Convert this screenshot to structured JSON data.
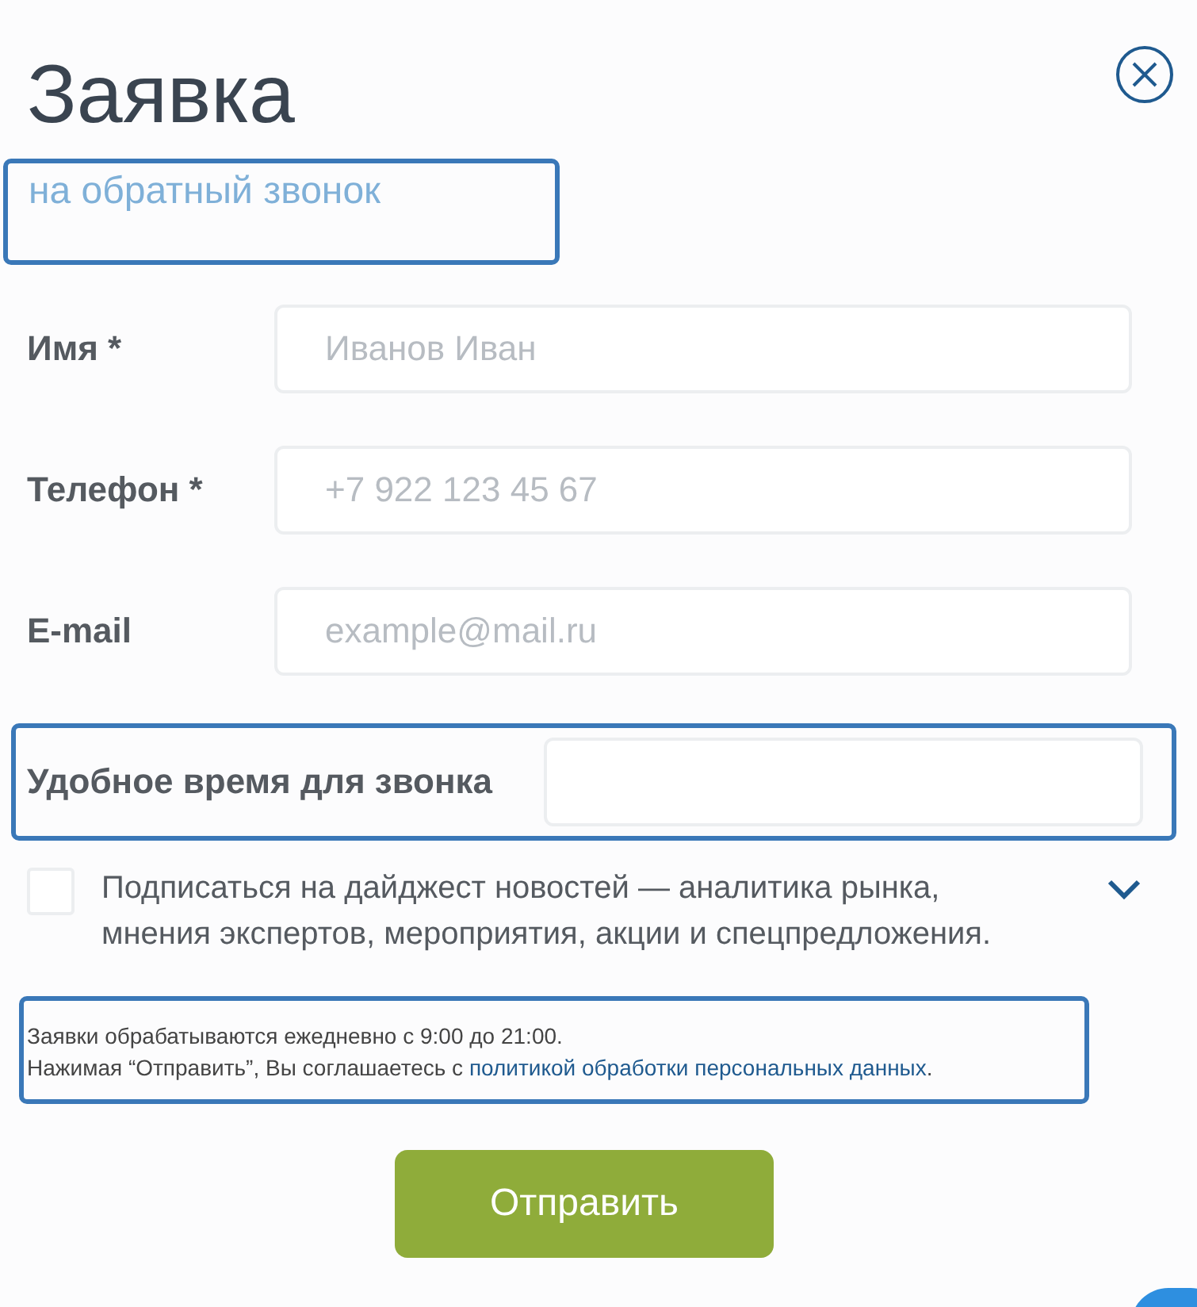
{
  "title": "Заявка",
  "subtitle": {
    "text": "на обратный звонок",
    "highlighted": true
  },
  "fields": [
    {
      "kind": "short",
      "label": "Имя *",
      "placeholder": "Иванов Иван",
      "highlighted": false
    },
    {
      "kind": "short",
      "label": "Телефон *",
      "placeholder": "+7 922 123 45 67",
      "highlighted": false
    },
    {
      "kind": "short",
      "label": "E-mail",
      "placeholder": "example@mail.ru",
      "highlighted": false
    },
    {
      "kind": "wide",
      "label": "Удобное время для звонка",
      "highlighted": true
    }
  ],
  "subscribe": {
    "checked": false,
    "text": "Подписаться на дайджест новостей — аналитика рынка, мнения экспертов, мероприятия, акции и спецпредложения."
  },
  "notice": {
    "highlighted": true,
    "line_1": "Заявки обрабатываются ежедневно с 9:00 до 21:00.",
    "line_2": "Нажимая “Отправить”, Вы соглашаетесь с ",
    "link": "политикой обработки персональных данных",
    "end": "."
  },
  "submit_button": "Отправить"
}
